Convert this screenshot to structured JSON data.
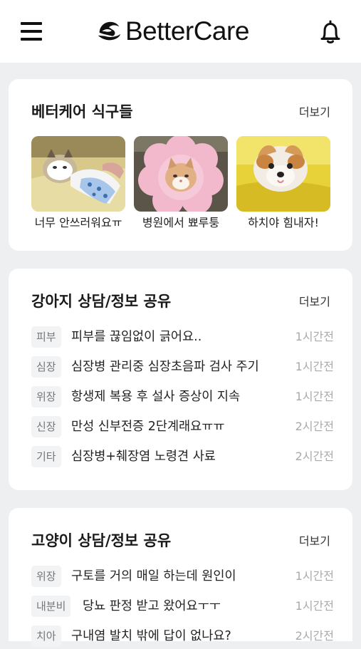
{
  "header": {
    "brand": "BetterCare"
  },
  "family": {
    "title": "베터케어 식구들",
    "more": "더보기",
    "items": [
      {
        "caption": "너무 안쓰러워요ㅠ"
      },
      {
        "caption": "병원에서 뾰루퉁"
      },
      {
        "caption": "하치야 힘내자!"
      }
    ]
  },
  "dog_board": {
    "title": "강아지 상담/정보 공유",
    "more": "더보기",
    "posts": [
      {
        "tag": "피부",
        "title": "피부를 끊임없이 긁어요..",
        "time": "1시간전"
      },
      {
        "tag": "심장",
        "title": "심장병 관리중 심장초음파 검사 주기",
        "time": "1시간전"
      },
      {
        "tag": "위장",
        "title": "항생제 복용 후 설사 증상이 지속",
        "time": "1시간전"
      },
      {
        "tag": "신장",
        "title": "만성 신부전증 2단계래요ㅠㅠ",
        "time": "2시간전"
      },
      {
        "tag": "기타",
        "title": "심장병+췌장염 노령견 사료",
        "time": "2시간전"
      }
    ]
  },
  "cat_board": {
    "title": "고양이 상담/정보 공유",
    "more": "더보기",
    "posts": [
      {
        "tag": "위장",
        "title": "구토를 거의 매일 하는데 원인이",
        "time": "1시간전"
      },
      {
        "tag": "내분비",
        "title": "당뇨 판정 받고 왔어요ㅜㅜ",
        "time": "1시간전"
      },
      {
        "tag": "치아",
        "title": "구내염 발치 밖에 답이 없나요?",
        "time": "2시간전"
      }
    ]
  }
}
